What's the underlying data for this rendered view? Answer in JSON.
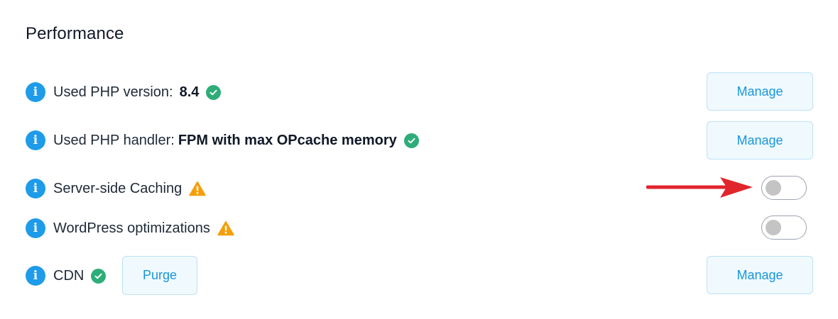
{
  "section": {
    "title": "Performance"
  },
  "rows": [
    {
      "label": "Used PHP version:",
      "value": "8.4",
      "status": "ok",
      "action_label": "Manage"
    },
    {
      "label": "Used PHP handler:",
      "value": "FPM with max OPcache memory",
      "status": "ok",
      "action_label": "Manage"
    },
    {
      "label": "Server-side Caching",
      "status": "warning",
      "toggle": "off"
    },
    {
      "label": "WordPress optimizations",
      "status": "warning",
      "toggle": "off"
    },
    {
      "label": "CDN",
      "status": "ok",
      "secondary_action_label": "Purge",
      "action_label": "Manage"
    }
  ],
  "icons": {
    "info": "info-icon",
    "ok": "check-circle-icon",
    "warning": "warning-triangle-icon",
    "annotation": "red-arrow-icon"
  },
  "colors": {
    "info": "#1e9be9",
    "ok": "#2ead79",
    "warning": "#f59e0b",
    "button_text": "#1896dd",
    "button_bg": "#f0f9fe",
    "button_border": "#bde1f6",
    "toggle_knob": "#c4c4c4",
    "annotation_arrow": "#e0262c"
  }
}
